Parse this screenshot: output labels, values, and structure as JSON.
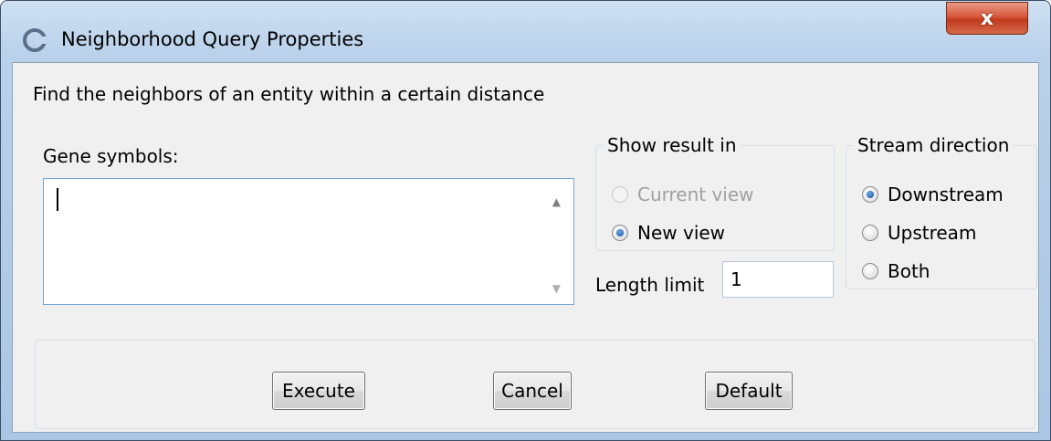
{
  "window": {
    "title": "Neighborhood Query Properties",
    "close_glyph": "x"
  },
  "description": "Find the neighbors of an entity within a certain distance",
  "gene_symbols": {
    "label": "Gene symbols:",
    "value": ""
  },
  "show_result": {
    "legend": "Show result in",
    "options": [
      {
        "label": "Current view",
        "checked": false,
        "disabled": true
      },
      {
        "label": "New view",
        "checked": true,
        "disabled": false
      }
    ]
  },
  "length_limit": {
    "label": "Length limit",
    "value": "1"
  },
  "stream_direction": {
    "legend": "Stream direction",
    "options": [
      {
        "label": "Downstream",
        "checked": true
      },
      {
        "label": "Upstream",
        "checked": false
      },
      {
        "label": "Both",
        "checked": false
      }
    ]
  },
  "buttons": {
    "execute": "Execute",
    "cancel": "Cancel",
    "default": "Default"
  },
  "colors": {
    "title_bar": "#b9d1ea",
    "close_button": "#c23a1d",
    "dialog_background": "#f0f0f0",
    "radio_checked": "#1c5aa3"
  },
  "icons": {
    "app": "app-logo-icon",
    "close": "close-icon"
  }
}
